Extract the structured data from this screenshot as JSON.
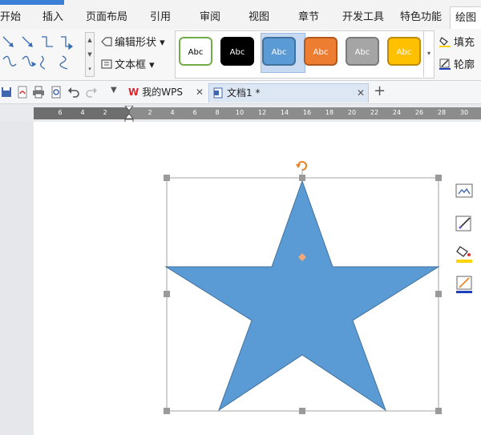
{
  "ribbon_tabs": [
    "开始",
    "插入",
    "页面布局",
    "引用",
    "审阅",
    "视图",
    "章节",
    "开发工具",
    "特色功能",
    "绘图"
  ],
  "ribbon": {
    "edit_shape_label": "编辑形状",
    "text_box_label": "文本框",
    "styles": [
      {
        "label": "Abc",
        "bg": "#ffffff",
        "border": "#70ad47",
        "color": "#000000"
      },
      {
        "label": "Abc",
        "bg": "#000000",
        "border": "#000000",
        "color": "#ffffff"
      },
      {
        "label": "Abc",
        "bg": "#5b9bd5",
        "border": "#41719c",
        "color": "#ffffff"
      },
      {
        "label": "Abc",
        "bg": "#ed7d31",
        "border": "#ae5a21",
        "color": "#ffffff"
      },
      {
        "label": "Abc",
        "bg": "#a5a5a5",
        "border": "#7b7b7b",
        "color": "#ffffff"
      },
      {
        "label": "Abc",
        "bg": "#ffc000",
        "border": "#bc8c00",
        "color": "#ffffff"
      }
    ],
    "fill_label": "填充",
    "outline_label": "轮廓"
  },
  "doc_tabs": {
    "wps_label": "我的WPS",
    "doc_label": "文档1 *",
    "add_label": "+"
  },
  "ruler": {
    "ticks": [
      "6",
      "4",
      "2",
      "2",
      "4",
      "6",
      "8",
      "10",
      "12",
      "14",
      "16",
      "18",
      "20",
      "22",
      "24",
      "26",
      "28",
      "30"
    ]
  },
  "shape": {
    "type": "star",
    "fill": "#5b9bd5",
    "stroke": "#41719c"
  },
  "colors": {
    "accent": "#3c7fd6",
    "handle": "#9a9a9a",
    "rotate_handle": "#e8821e"
  }
}
